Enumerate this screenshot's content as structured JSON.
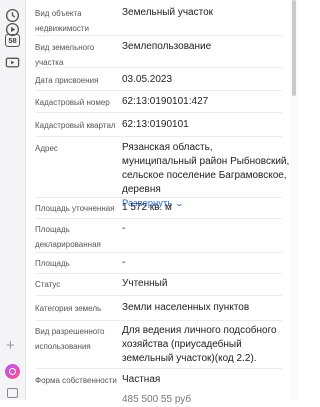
{
  "sidebar": {
    "badge_text": "58",
    "icons": [
      "clock-icon",
      "play-icon",
      "number-badge-icon",
      "video-icon",
      "plus-icon",
      "alice-assistant-icon",
      "panel-icon"
    ]
  },
  "rows": [
    {
      "label": "Вид объекта недвижимости",
      "value": "Земельный участок"
    },
    {
      "label": "Вид земельного участка",
      "value": "Землепользование"
    },
    {
      "label": "Дата присвоения",
      "value": "03.05.2023"
    },
    {
      "label": "Кадастровый номер",
      "value": "62:13:0190101:427"
    },
    {
      "label": "Кадастровый квартал",
      "value": "62:13:0190101"
    },
    {
      "label": "Адрес",
      "value": "Рязанская область, муниципальный район Рыбновский, сельское поселение Баграмовское, деревня",
      "link": "Развернуть"
    },
    {
      "label": "Площадь уточненная",
      "value": "1 572 кв. м"
    },
    {
      "label": "Площадь декларированная",
      "value": "-"
    },
    {
      "label": "Площадь",
      "value": "-"
    },
    {
      "label": "Статус",
      "value": "Учтенный"
    },
    {
      "label": "Категория земель",
      "value": "Земли населенных пунктов"
    },
    {
      "label": "Вид разрешенного использования",
      "value": "Для ведения личного подсобного хозяйства (приусадебный земельный участок)(код 2.2)."
    },
    {
      "label": "Форма собственности",
      "value": "Частная"
    }
  ],
  "cutoff_value": "485 500 55 руб"
}
